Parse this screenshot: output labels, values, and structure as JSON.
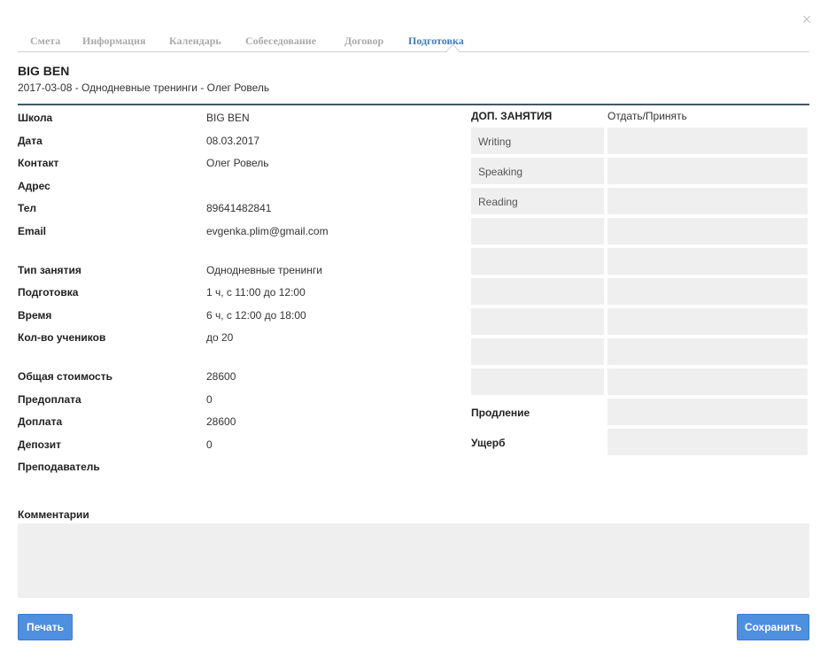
{
  "window": {
    "close_glyph": "×"
  },
  "tabs": [
    {
      "label": "Смета"
    },
    {
      "label": "Информация"
    },
    {
      "label": "Календарь"
    },
    {
      "label": "Собеседование"
    },
    {
      "label": "Договор"
    },
    {
      "label": "Подготовка",
      "active": true
    }
  ],
  "header": {
    "title": "BIG BEN",
    "subtitle": "2017-03-08 - Однодневные тренинги - Олег Ровель"
  },
  "info": {
    "school": {
      "label": "Школа",
      "value": "BIG BEN"
    },
    "date": {
      "label": "Дата",
      "value": "08.03.2017"
    },
    "contact": {
      "label": "Контакт",
      "value": "Олег Ровель"
    },
    "address": {
      "label": "Адрес",
      "value": ""
    },
    "phone": {
      "label": "Тел",
      "value": "89641482841"
    },
    "email": {
      "label": "Email",
      "value": "evgenka.plim@gmail.com"
    },
    "lesson_type": {
      "label": "Тип занятия",
      "value": "Однодневные тренинги"
    },
    "prep": {
      "label": "Подготовка",
      "value": "1 ч, с 11:00 до 12:00"
    },
    "time": {
      "label": "Время",
      "value": "6 ч, с 12:00 до 18:00"
    },
    "students": {
      "label": "Кол-во учеников",
      "value": "до 20"
    },
    "total": {
      "label": "Общая стоимость",
      "value": "28600"
    },
    "prepayment": {
      "label": "Предоплата",
      "value": "0"
    },
    "surcharge": {
      "label": "Доплата",
      "value": "28600"
    },
    "deposit": {
      "label": "Депозит",
      "value": "0"
    },
    "teacher": {
      "label": "Преподаватель",
      "value": ""
    }
  },
  "extra": {
    "header_left": "ДОП. ЗАНЯТИЯ",
    "header_right": "Отдать/Принять",
    "rows": [
      "Writing",
      "Speaking",
      "Reading",
      "",
      "",
      "",
      "",
      "",
      ""
    ],
    "extension_label": "Продление",
    "damage_label": "Ущерб"
  },
  "comments": {
    "label": "Комментарии",
    "value": ""
  },
  "buttons": {
    "print": "Печать",
    "save": "Сохранить"
  },
  "colors": {
    "accent": "#3b7bbf",
    "button": "#4e8fe0",
    "divider": "#44576b",
    "field_bg": "#efefef"
  }
}
